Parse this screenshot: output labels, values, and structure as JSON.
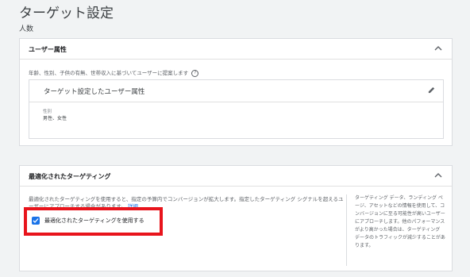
{
  "page": {
    "title": "ターゲット設定",
    "section_label": "人数"
  },
  "user_attributes_card": {
    "title": "ユーザー属性",
    "description": "年齢、性別、子供の有無、世帯収入に基づいてユーザーに提案します",
    "help_glyph": "?",
    "inner_title": "ターゲット設定したユーザー属性",
    "attribute_label": "性別",
    "attribute_value": "男性、女性"
  },
  "optimized_targeting_card": {
    "title": "最適化されたターゲティング",
    "description": "最適化されたターゲティングを使用すると、指定の予算内でコンバージョンが拡大します。指定したターゲティング シグナルを超えるユーザーにアプローチする場合があります。",
    "details_link": "詳細",
    "checkbox_label": "最適化されたターゲティングを使用する",
    "checkbox_checked": true,
    "side_note": "ターゲティング データ、ランディング ページ、アセットなどの情報を使用して、コンバージョンに至る可能性が高いユーザーにアプローチします。他のパフォーマンスがより高かった場合は、ターゲティング データのトラフィックが減少することがあります。"
  },
  "colors": {
    "accent": "#1a73e8",
    "highlight": "#e8141c",
    "background": "#f1f3f4"
  },
  "icons": [
    "chevron-up-icon",
    "edit-pencil-icon",
    "help-icon",
    "checkmark-icon"
  ]
}
